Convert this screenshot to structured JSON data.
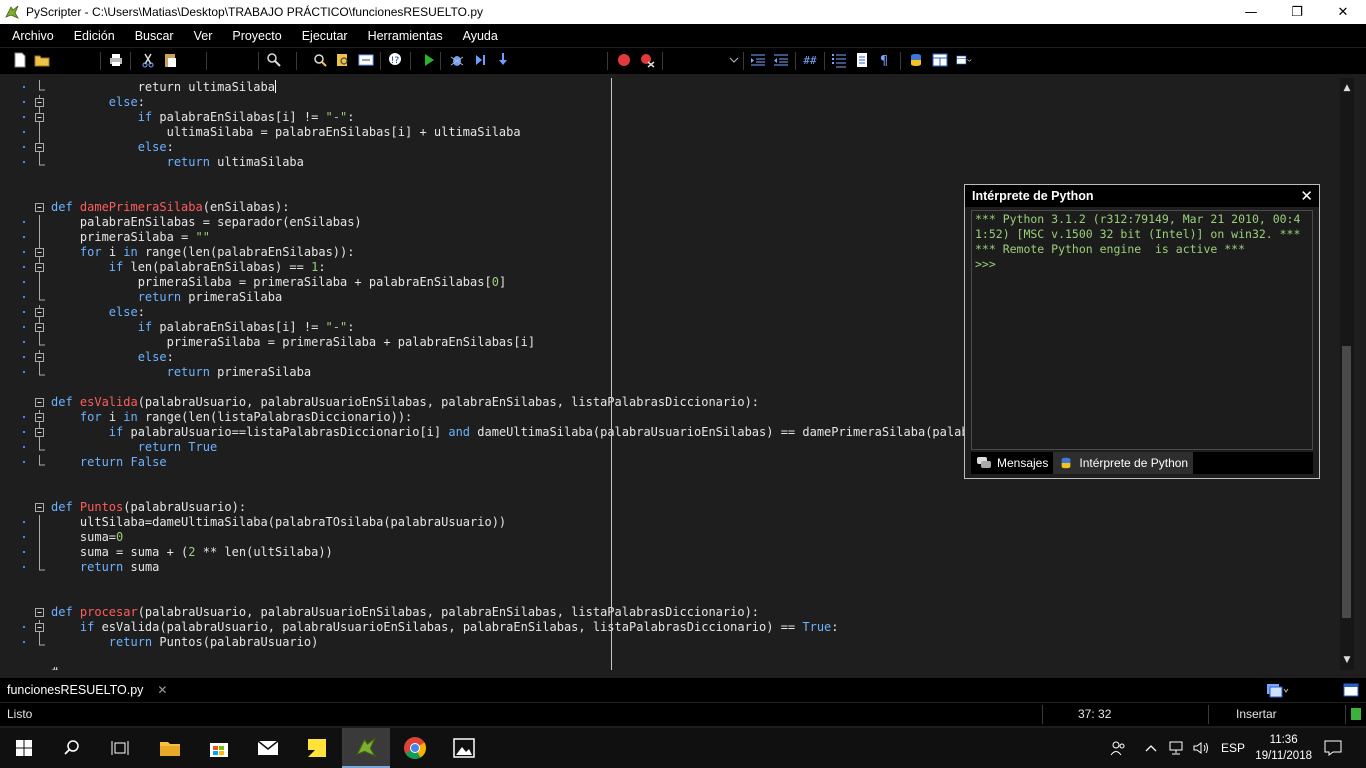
{
  "window": {
    "title": "PyScripter - C:\\Users\\Matias\\Desktop\\TRABAJO PRÁCTICO\\funcionesRESUELTO.py",
    "minimize": "—",
    "maximize": "❐",
    "close": "✕"
  },
  "menu": [
    "Archivo",
    "Edición",
    "Buscar",
    "Ver",
    "Proyecto",
    "Ejecutar",
    "Herramientas",
    "Ayuda"
  ],
  "toolbar_icons": [
    "new-file-icon",
    "open-file-icon",
    "print-icon",
    "cut-icon",
    "paste-icon",
    "find-icon",
    "replace-icon",
    "find-in-files-icon",
    "goto-icon",
    "syntax-check-icon",
    "run-icon",
    "debug-icon",
    "step-icon",
    "step-into-icon",
    "breakpoint-icon",
    "clear-breakpoints-icon",
    "indent-icon",
    "dedent-icon",
    "comment-icon",
    "list-icon",
    "file-info-icon",
    "paragraph-icon",
    "python-icon",
    "layout-icon",
    "layout-dropdown-icon"
  ],
  "editor": {
    "lines": [
      [
        [
          "            return ultimaSilaba",
          ""
        ]
      ],
      [
        [
          "        ",
          ""
        ],
        [
          "else",
          "kw"
        ],
        [
          ":",
          ""
        ]
      ],
      [
        [
          "            ",
          ""
        ],
        [
          "if",
          "kw"
        ],
        [
          " palabraEnSilabas[i] != ",
          ""
        ],
        [
          "\"-\"",
          "str"
        ],
        [
          ":",
          ""
        ]
      ],
      [
        [
          "                ultimaSilaba = palabraEnSilabas[i] + ultimaSilaba",
          ""
        ]
      ],
      [
        [
          "            ",
          ""
        ],
        [
          "else",
          "kw"
        ],
        [
          ":",
          ""
        ]
      ],
      [
        [
          "                ",
          ""
        ],
        [
          "return",
          "kw"
        ],
        [
          " ultimaSilaba",
          ""
        ]
      ],
      [
        [
          "",
          ""
        ]
      ],
      [
        [
          "",
          ""
        ]
      ],
      [
        [
          "def ",
          "kw"
        ],
        [
          "damePrimeraSilaba",
          "fn"
        ],
        [
          "(enSilabas):",
          ""
        ]
      ],
      [
        [
          "    palabraEnSilabas = separador(enSilabas)",
          ""
        ]
      ],
      [
        [
          "    primeraSilaba = ",
          ""
        ],
        [
          "\"\"",
          "str"
        ]
      ],
      [
        [
          "    ",
          ""
        ],
        [
          "for",
          "kw"
        ],
        [
          " i ",
          ""
        ],
        [
          "in",
          "kw"
        ],
        [
          " range(len(palabraEnSilabas)):",
          ""
        ]
      ],
      [
        [
          "        ",
          ""
        ],
        [
          "if",
          "kw"
        ],
        [
          " len(palabraEnSilabas) == ",
          ""
        ],
        [
          "1",
          "num"
        ],
        [
          ":",
          ""
        ]
      ],
      [
        [
          "            primeraSilaba = primeraSilaba + palabraEnSilabas[",
          ""
        ],
        [
          "0",
          "num"
        ],
        [
          "]",
          ""
        ]
      ],
      [
        [
          "            ",
          ""
        ],
        [
          "return",
          "kw"
        ],
        [
          " primeraSilaba",
          ""
        ]
      ],
      [
        [
          "        ",
          ""
        ],
        [
          "else",
          "kw"
        ],
        [
          ":",
          ""
        ]
      ],
      [
        [
          "            ",
          ""
        ],
        [
          "if",
          "kw"
        ],
        [
          " palabraEnSilabas[i] != ",
          ""
        ],
        [
          "\"-\"",
          "str"
        ],
        [
          ":",
          ""
        ]
      ],
      [
        [
          "                primeraSilaba = primeraSilaba + palabraEnSilabas[i]",
          ""
        ]
      ],
      [
        [
          "            ",
          ""
        ],
        [
          "else",
          "kw"
        ],
        [
          ":",
          ""
        ]
      ],
      [
        [
          "                ",
          ""
        ],
        [
          "return",
          "kw"
        ],
        [
          " primeraSilaba",
          ""
        ]
      ],
      [
        [
          "",
          ""
        ]
      ],
      [
        [
          "def ",
          "kw"
        ],
        [
          "esValida",
          "fn"
        ],
        [
          "(palabraUsuario, palabraUsuarioEnSilabas, palabraEnSilabas, listaPalabrasDiccionario):",
          ""
        ]
      ],
      [
        [
          "    ",
          ""
        ],
        [
          "for",
          "kw"
        ],
        [
          " i ",
          ""
        ],
        [
          "in",
          "kw"
        ],
        [
          " range(len(listaPalabrasDiccionario)):",
          ""
        ]
      ],
      [
        [
          "        ",
          ""
        ],
        [
          "if",
          "kw"
        ],
        [
          " palabraUsuario==listaPalabrasDiccionario[i] ",
          ""
        ],
        [
          "and",
          "kw"
        ],
        [
          " dameUltimaSilaba(palabraUsuarioEnSilabas) == damePrimeraSilaba(palabraEnSilabas):",
          ""
        ]
      ],
      [
        [
          "            ",
          ""
        ],
        [
          "return",
          "kw"
        ],
        [
          " ",
          ""
        ],
        [
          "True",
          "kw"
        ]
      ],
      [
        [
          "    ",
          ""
        ],
        [
          "return",
          "kw"
        ],
        [
          " ",
          ""
        ],
        [
          "False",
          "kw"
        ]
      ],
      [
        [
          "",
          ""
        ]
      ],
      [
        [
          "",
          ""
        ]
      ],
      [
        [
          "def ",
          "kw"
        ],
        [
          "Puntos",
          "fn"
        ],
        [
          "(palabraUsuario):",
          ""
        ]
      ],
      [
        [
          "    ultSilaba=dameUltimaSilaba(palabraTOsilaba(palabraUsuario))",
          ""
        ]
      ],
      [
        [
          "    suma=",
          ""
        ],
        [
          "0",
          "num"
        ]
      ],
      [
        [
          "    suma = suma + (",
          ""
        ],
        [
          "2",
          "num"
        ],
        [
          " ** len(ultSilaba))",
          ""
        ]
      ],
      [
        [
          "    ",
          ""
        ],
        [
          "return",
          "kw"
        ],
        [
          " suma",
          ""
        ]
      ],
      [
        [
          "",
          ""
        ]
      ],
      [
        [
          "",
          ""
        ]
      ],
      [
        [
          "def ",
          "kw"
        ],
        [
          "procesar",
          "fn"
        ],
        [
          "(palabraUsuario, palabraUsuarioEnSilabas, palabraEnSilabas, listaPalabrasDiccionario):",
          ""
        ]
      ],
      [
        [
          "    ",
          ""
        ],
        [
          "if",
          "kw"
        ],
        [
          " esValida(palabraUsuario, palabraUsuarioEnSilabas, palabraEnSilabas, listaPalabrasDiccionario) == ",
          ""
        ],
        [
          "True",
          "kw"
        ],
        [
          ":",
          ""
        ]
      ],
      [
        [
          "        ",
          ""
        ],
        [
          "return",
          "kw"
        ],
        [
          " Puntos(palabraUsuario)",
          ""
        ]
      ],
      [
        [
          "",
          ""
        ]
      ],
      [
        [
          "#",
          ""
        ]
      ]
    ]
  },
  "interpreter": {
    "title": "Intérprete de Python",
    "close": "✕",
    "output": "*** Python 3.1.2 (r312:79149, Mar 21 2010, 00:41:52) [MSC v.1500 32 bit (Intel)] on win32. ***\n*** Remote Python engine  is active ***\n>>>",
    "tabs": [
      "Mensajes",
      "Intérprete de Python"
    ]
  },
  "file_tab": {
    "name": "funcionesRESUELTO.py",
    "close": "✕"
  },
  "status": {
    "state": "Listo",
    "position": "37: 32",
    "mode": "Insertar"
  },
  "taskbar": {
    "language": "ESP",
    "time": "11:36",
    "date": "19/11/2018"
  }
}
